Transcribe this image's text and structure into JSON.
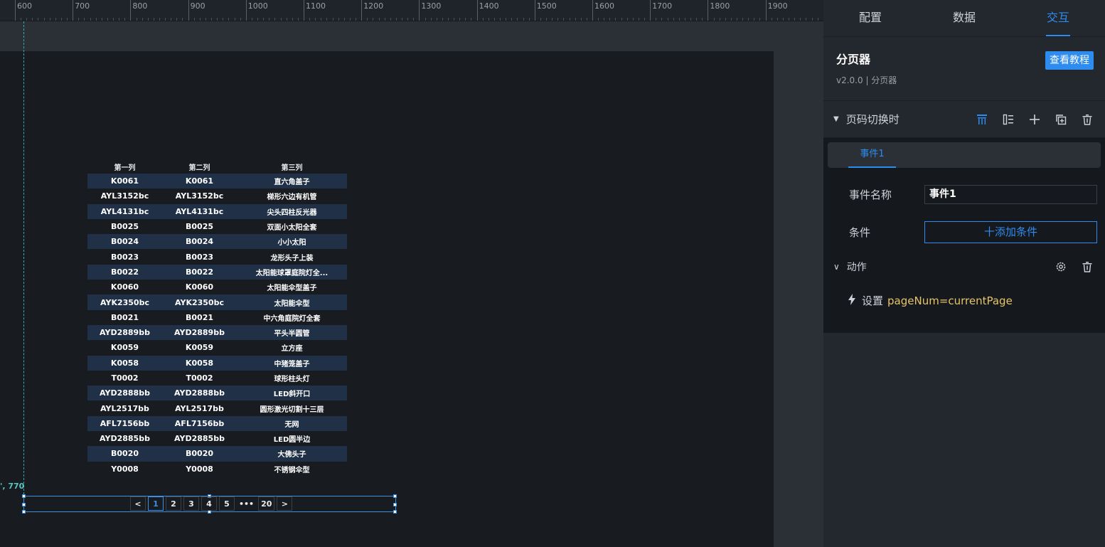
{
  "ruler": {
    "labels": [
      "600",
      "700",
      "800",
      "900",
      "1000",
      "1100",
      "1200",
      "1300",
      "1400",
      "1500",
      "1600",
      "1700",
      "1800",
      "1900"
    ]
  },
  "canvas": {
    "coord_label": "', 770"
  },
  "table": {
    "headers": [
      "第一列",
      "第二列",
      "第三列"
    ],
    "rows": [
      [
        "K0061",
        "K0061",
        "直六角盖子"
      ],
      [
        "AYL3152bc",
        "AYL3152bc",
        "梯形六边有机管"
      ],
      [
        "AYL4131bc",
        "AYL4131bc",
        "尖头四柱反光器"
      ],
      [
        "B0025",
        "B0025",
        "双面小太阳全套"
      ],
      [
        "B0024",
        "B0024",
        "小小太阳"
      ],
      [
        "B0023",
        "B0023",
        "龙形头子上装"
      ],
      [
        "B0022",
        "B0022",
        "太阳能球罩庭院灯全..."
      ],
      [
        "K0060",
        "K0060",
        "太阳能伞型盖子"
      ],
      [
        "AYK2350bc",
        "AYK2350bc",
        "太阳能伞型"
      ],
      [
        "B0021",
        "B0021",
        "中六角庭院灯全套"
      ],
      [
        "AYD2889bb",
        "AYD2889bb",
        "平头半圆管"
      ],
      [
        "K0059",
        "K0059",
        "立方座"
      ],
      [
        "K0058",
        "K0058",
        "中猪笼盖子"
      ],
      [
        "T0002",
        "T0002",
        "球形柱头灯"
      ],
      [
        "AYD2888bb",
        "AYD2888bb",
        "LED斜开口"
      ],
      [
        "AYL2517bb",
        "AYL2517bb",
        "圆形激光切割十三层"
      ],
      [
        "AFL7156bb",
        "AFL7156bb",
        "无网"
      ],
      [
        "AYD2885bb",
        "AYD2885bb",
        "LED圆半边"
      ],
      [
        "B0020",
        "B0020",
        "大佛头子"
      ],
      [
        "Y0008",
        "Y0008",
        "不锈钢伞型"
      ]
    ]
  },
  "pager": {
    "prev": "<",
    "pages": [
      "1",
      "2",
      "3",
      "4",
      "5"
    ],
    "ellipsis": "•••",
    "last": "20",
    "next": ">",
    "active": "1"
  },
  "panel": {
    "tabs": [
      "配置",
      "数据",
      "交互"
    ],
    "active_tab": "交互",
    "component_title": "分页器",
    "component_meta": "v2.0.0 | 分页器",
    "tutorial_button": "查看教程",
    "event_section": "页码切换时",
    "event_tab": "事件1",
    "event_name_label": "事件名称",
    "event_name_value": "事件1",
    "condition_label": "条件",
    "add_condition": "十添加条件",
    "action_title": "动作",
    "action_prefix": "设置",
    "action_expr": "pageNum=currentPage"
  },
  "colors": {
    "accent": "#2e8cf0",
    "expr": "#e6c46a",
    "stripe": "#1f3047"
  }
}
